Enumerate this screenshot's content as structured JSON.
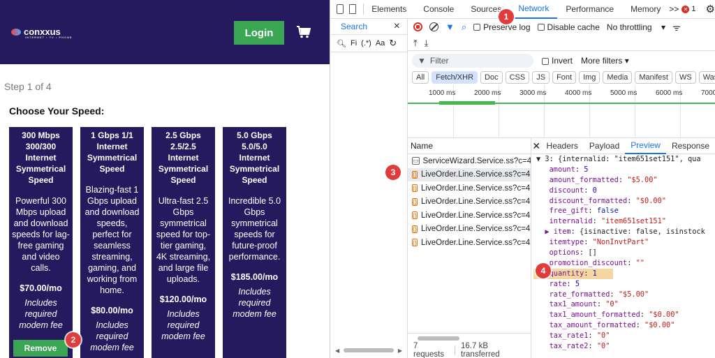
{
  "site": {
    "logo_text": "conxxus",
    "logo_tagline": "INTERNET • TV • PHONE",
    "login_label": "Login",
    "step_text": "Step 1 of 4",
    "heading": "Choose Your Speed:",
    "plans": [
      {
        "title": "300 Mbps 300/300 Internet Symmetrical Speed",
        "desc": "Powerful 300 Mbps upload and download speeds for lag-free gaming and video calls.",
        "price": "$70.00/mo",
        "fee": "Includes required modem fee"
      },
      {
        "title": "1 Gbps 1/1 Internet Symmetrical Speed",
        "desc": "Blazing-fast 1 Gbps upload and download speeds, perfect for seamless streaming, gaming, and working from home.",
        "price": "$80.00/mo",
        "fee": "Includes required modem fee"
      },
      {
        "title": "2.5 Gbps 2.5/2.5 Internet Symmetrical Speed",
        "desc": "Ultra-fast 2.5 Gbps symmetrical speed for top-tier gaming, 4K streaming, and large file uploads.",
        "price": "$120.00/mo",
        "fee": "Includes required modem fee"
      },
      {
        "title": "5.0 Gbps 5.0/5.0 Internet Symmetrical Speed",
        "desc": "Incredible 5.0 Gbps symmetrical speeds for future-proof performance.",
        "price": "$185.00/mo",
        "fee": "Includes required modem fee"
      }
    ],
    "remove_label": "Remove"
  },
  "callouts": [
    "1",
    "2",
    "3",
    "4"
  ],
  "devtools": {
    "tabs": [
      "Elements",
      "Console",
      "Sources",
      "Network",
      "Performance",
      "Memory"
    ],
    "more": ">>",
    "error_count": "1",
    "search_tab": "Search",
    "search_placeholder": "Fi",
    "regex_label": "(.*)",
    "case_label": "Aa",
    "preserve_log": "Preserve log",
    "disable_cache": "Disable cache",
    "throttling": "No throttling",
    "filter_placeholder": "Filter",
    "invert": "Invert",
    "more_filters": "More filters",
    "type_filters": [
      "All",
      "Fetch/XHR",
      "Doc",
      "CSS",
      "JS",
      "Font",
      "Img",
      "Media",
      "Manifest",
      "WS",
      "Wasm",
      "O"
    ],
    "timeline_labels": [
      "1000 ms",
      "2000 ms",
      "3000 ms",
      "4000 ms",
      "5000 ms",
      "6000 ms",
      "7000"
    ],
    "name_header": "Name",
    "requests": [
      "ServiceWizard.Service.ss?c=4...",
      "LiveOrder.Line.Service.ss?c=4...",
      "LiveOrder.Line.Service.ss?c=4...",
      "LiveOrder.Line.Service.ss?c=4...",
      "LiveOrder.Line.Service.ss?c=4...",
      "LiveOrder.Line.Service.ss?c=4...",
      "LiveOrder.Line.Service.ss?c=4..."
    ],
    "status_requests": "7 requests",
    "status_transferred": "16.7 kB transferred",
    "detail_tabs": [
      "Headers",
      "Payload",
      "Preview",
      "Response"
    ],
    "preview_lines": [
      {
        "key": "▼ 3: ",
        "val": "{internalid: \"item651set151\", qua",
        "type": "plain"
      },
      {
        "key": "amount",
        "val": "5",
        "type": "n"
      },
      {
        "key": "amount_formatted",
        "val": "\"$5.00\"",
        "type": "s"
      },
      {
        "key": "discount",
        "val": "0",
        "type": "n"
      },
      {
        "key": "discount_formatted",
        "val": "\"$0.00\"",
        "type": "s"
      },
      {
        "key": "free_gift",
        "val": "false",
        "type": "b"
      },
      {
        "key": "internalid",
        "val": "\"item651set151\"",
        "type": "s"
      },
      {
        "key": "▶ item",
        "val": "{isinactive: false, isinstock",
        "type": "plain"
      },
      {
        "key": "itemtype",
        "val": "\"NonInvtPart\"",
        "type": "s"
      },
      {
        "key": "options",
        "val": "[]",
        "type": "plain"
      },
      {
        "key": "promotion_discount",
        "val": "\"\"",
        "type": "s"
      },
      {
        "key": "quantity",
        "val": "1",
        "type": "n"
      },
      {
        "key": "rate",
        "val": "5",
        "type": "n"
      },
      {
        "key": "rate_formatted",
        "val": "\"$5.00\"",
        "type": "s"
      },
      {
        "key": "tax1_amount",
        "val": "\"0\"",
        "type": "s"
      },
      {
        "key": "tax1_amount_formatted",
        "val": "\"$0.00\"",
        "type": "s"
      },
      {
        "key": "tax_amount_formatted",
        "val": "\"$0.00\"",
        "type": "s"
      },
      {
        "key": "tax_rate1",
        "val": "\"0\"",
        "type": "s"
      },
      {
        "key": "tax_rate2",
        "val": "\"0\"",
        "type": "s"
      }
    ]
  }
}
